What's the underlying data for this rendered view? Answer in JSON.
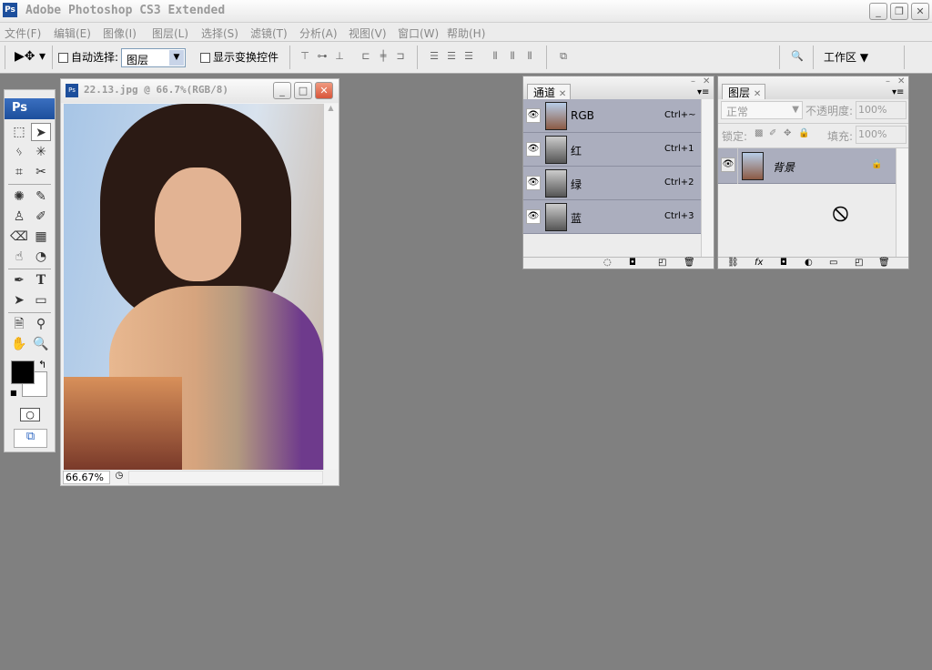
{
  "app": {
    "title": "Adobe Photoshop CS3 Extended",
    "icon": "Ps"
  },
  "window_buttons": {
    "minimize": "_",
    "restore": "❐",
    "close": "✕"
  },
  "menu": [
    "文件(F)",
    "编辑(E)",
    "图像(I)",
    "图层(L)",
    "选择(S)",
    "滤镜(T)",
    "分析(A)",
    "视图(V)",
    "窗口(W)",
    "帮助(H)"
  ],
  "options": {
    "auto_select_label": "自动选择:",
    "auto_select_value": "图层",
    "show_transform_label": "显示变换控件",
    "workspace_label": "工作区 ▼"
  },
  "toolbox": {
    "logo": "Ps"
  },
  "document": {
    "title": "22.13.jpg @ 66.7%(RGB/8)",
    "zoom": "66.67%"
  },
  "channels": {
    "tab": "通道",
    "rows": [
      {
        "name": "RGB",
        "shortcut": "Ctrl+~"
      },
      {
        "name": "红",
        "shortcut": "Ctrl+1"
      },
      {
        "name": "绿",
        "shortcut": "Ctrl+2"
      },
      {
        "name": "蓝",
        "shortcut": "Ctrl+3"
      }
    ]
  },
  "layers": {
    "tab": "图层",
    "blend_mode": "正常",
    "opacity_label": "不透明度:",
    "opacity": "100%",
    "lock_label": "锁定:",
    "fill_label": "填充:",
    "fill": "100%",
    "items": [
      {
        "name": "背景"
      }
    ]
  },
  "colors": {
    "workspace": "#808080",
    "selected_row": "#abaebe",
    "title_blue": "#1d4f9c"
  }
}
